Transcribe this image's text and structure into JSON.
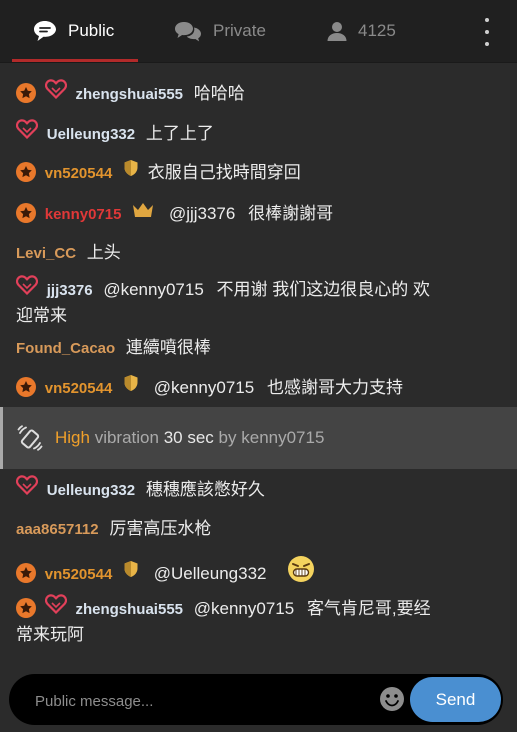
{
  "tabs": {
    "public": {
      "label": "Public",
      "icon": "chat-bubble-icon"
    },
    "private": {
      "label": "Private",
      "icon": "private-chat-icon"
    },
    "viewers": {
      "label": "4125",
      "icon": "user-icon"
    }
  },
  "colors": {
    "username_white": "#d9e3ee",
    "username_orange": "#e2942e",
    "username_red": "#e03838",
    "username_tan": "#d89a5a",
    "star_badge": "#e9782b",
    "heart_badge": "#e2405a",
    "shield_badge": "#e8b447",
    "crown_badge": "#e0a640",
    "send_button": "#4a8fd1",
    "active_tab_underline": "#b22a2a"
  },
  "messages": [
    {
      "user": "zhengshuai555",
      "text": "哈哈哈"
    },
    {
      "user": "Uelleung332",
      "text": "上了上了"
    },
    {
      "user": "vn520544",
      "text": "衣服自己找時間穿回"
    },
    {
      "user": "kenny0715",
      "mention": "@jjj3376",
      "text": "很棒謝謝哥"
    },
    {
      "user": "Levi_CC",
      "text": "上头"
    },
    {
      "user": "jjj3376",
      "mention": "@kenny0715",
      "text_line1": "不用谢 我们这边很良心的 欢",
      "text_line2": "迎常来"
    },
    {
      "user": "Found_Cacao",
      "text": "連續噴很棒"
    },
    {
      "user": "vn520544",
      "mention": "@kenny0715",
      "text": "也感謝哥大力支持"
    },
    {
      "user": "Uelleung332",
      "text": "穗穗應該憋好久"
    },
    {
      "user": "aaa8657112",
      "text": "厉害高压水枪"
    },
    {
      "user": "vn520544",
      "mention": "@Uelleung332",
      "emoji": "grinning-emoji-icon"
    },
    {
      "user": "zhengshuai555",
      "mention": "@kenny0715",
      "text_line1": "客气肯尼哥,要经",
      "text_line2": "常来玩阿"
    }
  ],
  "vibration": {
    "level": "High",
    "word": "vibration",
    "duration": "30 sec",
    "by": "by",
    "user": "kenny0715",
    "icon": "vibration-icon"
  },
  "composer": {
    "placeholder": "Public message...",
    "send_label": "Send",
    "emoji_icon": "smiley-icon"
  }
}
